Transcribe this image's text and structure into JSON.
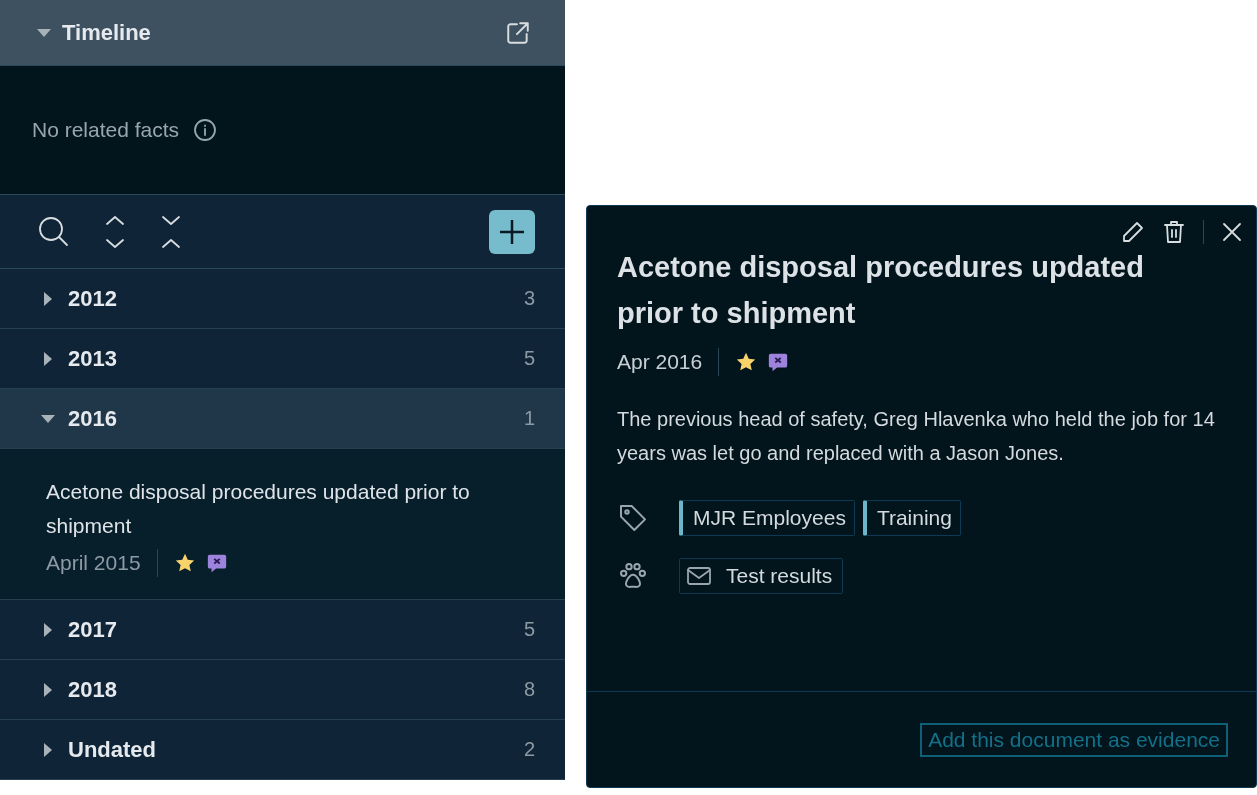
{
  "timeline": {
    "title": "Timeline",
    "expanded": true,
    "empty_message": "No related facts",
    "years": [
      {
        "label": "2012",
        "count": "3",
        "expanded": false
      },
      {
        "label": "2013",
        "count": "5",
        "expanded": false
      },
      {
        "label": "2016",
        "count": "1",
        "expanded": true,
        "children": [
          {
            "title": "Acetone disposal procedures updated prior to shipment",
            "date": "April 2015",
            "starred": true,
            "flagged": true
          }
        ]
      },
      {
        "label": "2017",
        "count": "5",
        "expanded": false
      },
      {
        "label": "2018",
        "count": "8",
        "expanded": false
      },
      {
        "label": "Undated",
        "count": "2",
        "expanded": false
      }
    ]
  },
  "fact": {
    "title": "Acetone disposal procedures updated prior to shipment",
    "date": "Apr 2016",
    "starred": true,
    "flagged": true,
    "description": "The previous head of safety, Greg Hlavenka who held the job for 14 years was let go and replaced with a Jason Jones.",
    "tags": [
      "MJR Employees",
      "Training"
    ],
    "evidence": [
      {
        "kind": "email",
        "label": "Test results"
      }
    ],
    "action": "Add this document as evidence"
  }
}
